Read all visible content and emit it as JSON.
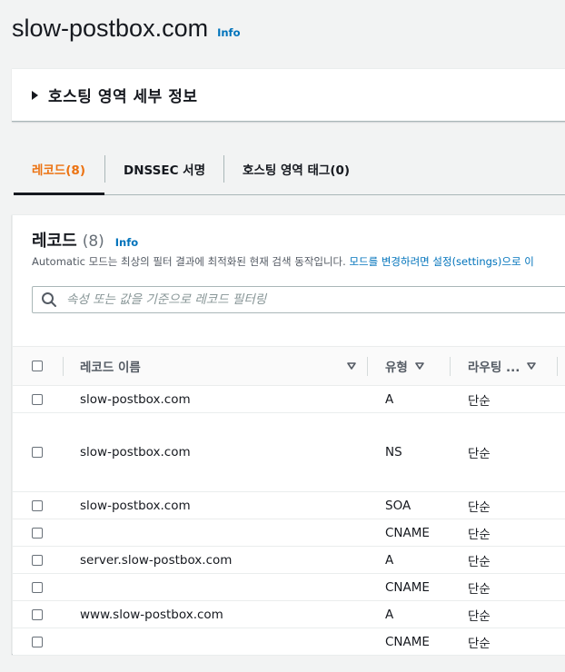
{
  "page": {
    "title": "slow-postbox.com",
    "info": "Info"
  },
  "hosted_zone_details": {
    "label": "호스팅 영역 세부 정보"
  },
  "tabs": [
    {
      "label": "레코드(8)",
      "active": true
    },
    {
      "label": "DNSSEC 서명",
      "active": false
    },
    {
      "label": "호스팅 영역 태그(0)",
      "active": false
    }
  ],
  "records_panel": {
    "title": "레코드",
    "count": "(8)",
    "info": "Info",
    "description": "Automatic 모드는 최상의 필터 결과에 최적화된 현재 검색 동작입니다.",
    "description_link": "모드를 변경하려면 설정(settings)으로 이",
    "search_placeholder": "속성 또는 값을 기준으로 레코드 필터링"
  },
  "table": {
    "columns": [
      "레코드 이름",
      "유형",
      "라우팅 ..."
    ],
    "rows": [
      {
        "name": "slow-postbox.com",
        "type": "A",
        "routing": "단순"
      },
      {
        "name": "slow-postbox.com",
        "type": "NS",
        "routing": "단순"
      },
      {
        "name": "slow-postbox.com",
        "type": "SOA",
        "routing": "단순"
      },
      {
        "name": "",
        "type": "CNAME",
        "routing": "단순"
      },
      {
        "name": "server.slow-postbox.com",
        "type": "A",
        "routing": "단순"
      },
      {
        "name": "",
        "type": "CNAME",
        "routing": "단순"
      },
      {
        "name": "www.slow-postbox.com",
        "type": "A",
        "routing": "단순"
      },
      {
        "name": "",
        "type": "CNAME",
        "routing": "단순"
      }
    ]
  },
  "colors": {
    "accent": "#ec7211",
    "link": "#0073bb"
  },
  "icons": {
    "expander": "caret-right-icon",
    "search": "search-icon",
    "sort": "sort-down-icon"
  }
}
